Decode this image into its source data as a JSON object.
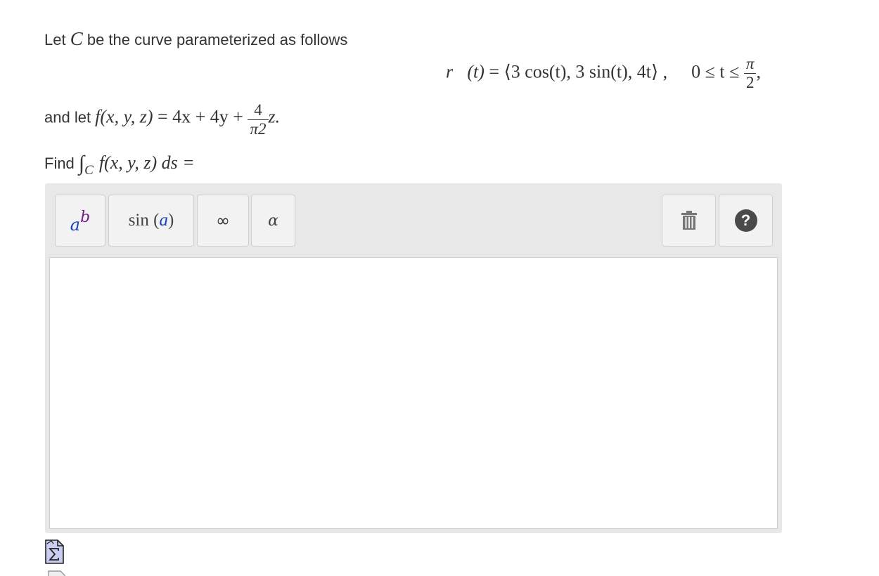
{
  "problem": {
    "intro": {
      "text_before": "Let ",
      "var": "C",
      "text_after": " be the curve parameterized as follows"
    },
    "param_eq": {
      "lhs": "r⃗(t)",
      "equals": " = ",
      "rhs": "⟨3 cos(t), 3 sin(t), 4t⟩ ,",
      "range_left": "0 ≤ t ≤",
      "range_num": "π",
      "range_den": "2",
      "trailing": ","
    },
    "function_def": {
      "text": "and let ",
      "lhs": "f(x, y, z)",
      "middle": " = 4x + 4y + ",
      "frac_num": "4",
      "frac_den": "π2",
      "tail": "z."
    },
    "find": {
      "text": "Find ",
      "integral": "∫",
      "sub": "C",
      "expr": "f(x, y, z) ds ="
    }
  },
  "toolbar": {
    "power": {
      "base": "a",
      "exp": "b"
    },
    "sin": {
      "prefix": "sin (",
      "arg": "a",
      "suffix": ")"
    },
    "infinity": "∞",
    "alpha": "α",
    "help": "?"
  },
  "answer": {
    "value": ""
  },
  "icons": {
    "trash": "trash-icon",
    "help": "help-icon",
    "sigma": "sigma-document-icon"
  },
  "colors": {
    "toolbar_bg": "#e8e8e8",
    "button_bg": "#f2f2f2",
    "power_base": "#1a3fbf",
    "power_exp": "#7b1b8c"
  }
}
